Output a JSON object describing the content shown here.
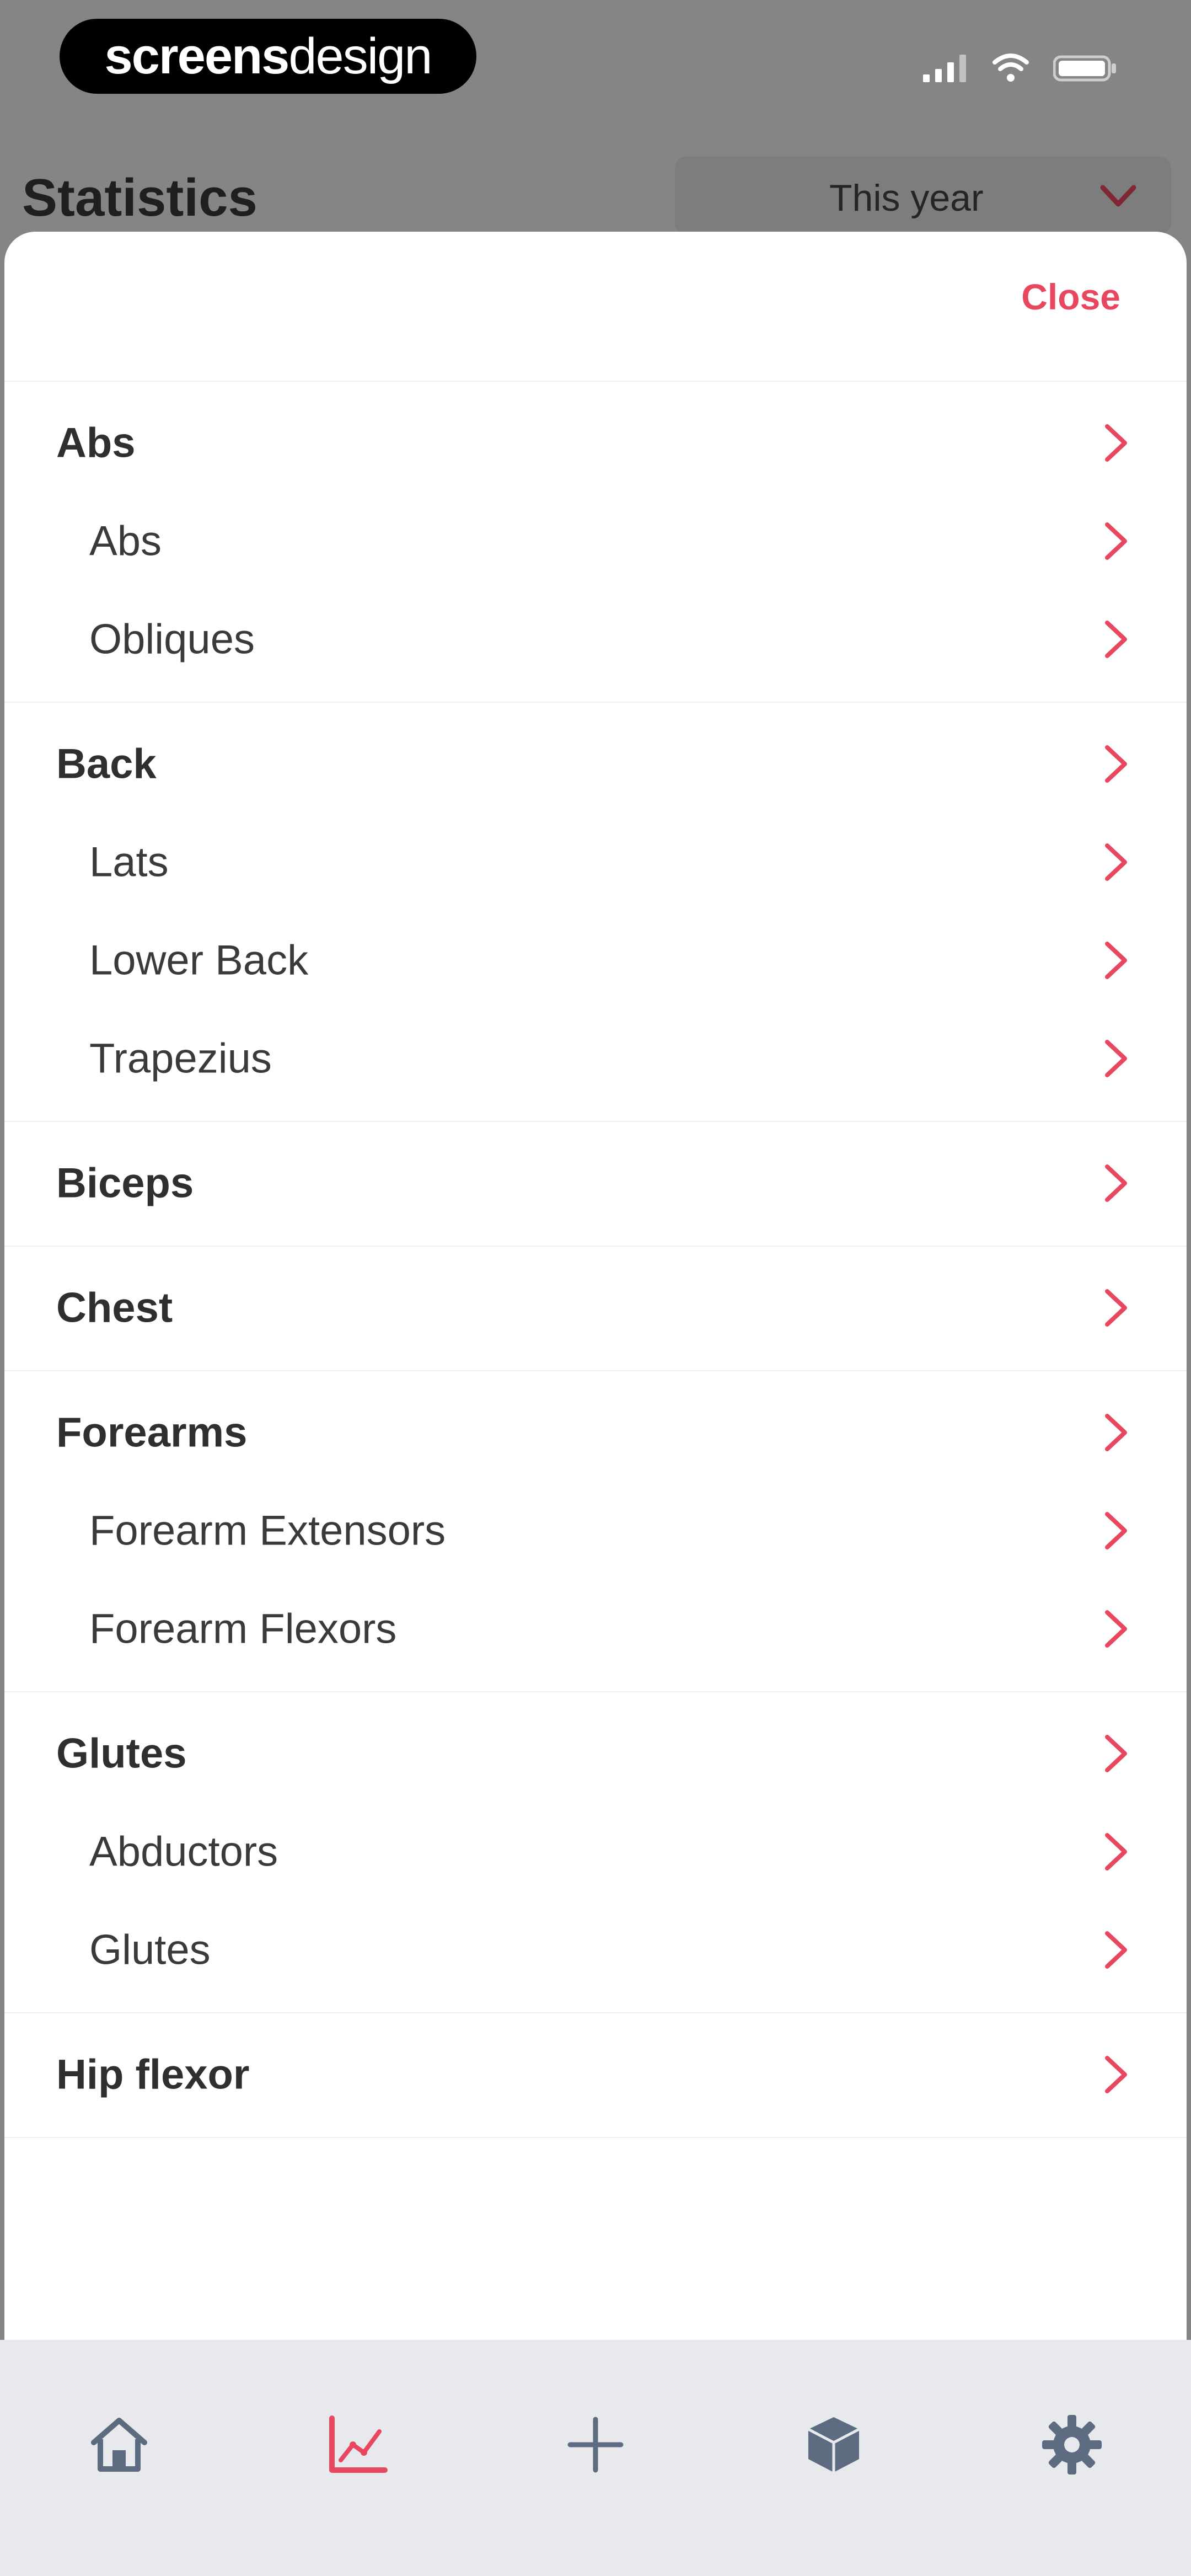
{
  "status_bar": {
    "brand": {
      "bold_part": "screens",
      "light_part": "design"
    },
    "icons": [
      "cellular-signal-icon",
      "wifi-icon",
      "battery-icon"
    ]
  },
  "background_screen": {
    "title": "Statistics",
    "period_select": {
      "value": "This year",
      "icon": "chevron-down-icon"
    }
  },
  "sheet": {
    "close_label": "Close",
    "groups": [
      {
        "label": "Abs",
        "children": [
          "Abs",
          "Obliques"
        ]
      },
      {
        "label": "Back",
        "children": [
          "Lats",
          "Lower Back",
          "Trapezius"
        ]
      },
      {
        "label": "Biceps",
        "children": []
      },
      {
        "label": "Chest",
        "children": []
      },
      {
        "label": "Forearms",
        "children": [
          "Forearm Extensors",
          "Forearm Flexors"
        ]
      },
      {
        "label": "Glutes",
        "children": [
          "Abductors",
          "Glutes"
        ]
      },
      {
        "label": "Hip flexor",
        "children": []
      }
    ]
  },
  "tab_bar": {
    "tabs": [
      {
        "icon": "home-icon",
        "active": false
      },
      {
        "icon": "statistics-chart-icon",
        "active": true
      },
      {
        "icon": "add-icon",
        "active": false
      },
      {
        "icon": "cube-icon",
        "active": false
      },
      {
        "icon": "settings-gear-icon",
        "active": false
      }
    ]
  },
  "colors": {
    "accent": "#e8485f",
    "tab_icon": "#5c6b7f",
    "tab_bar_bg": "#e8e9ec",
    "text_primary": "#2f2f31"
  }
}
